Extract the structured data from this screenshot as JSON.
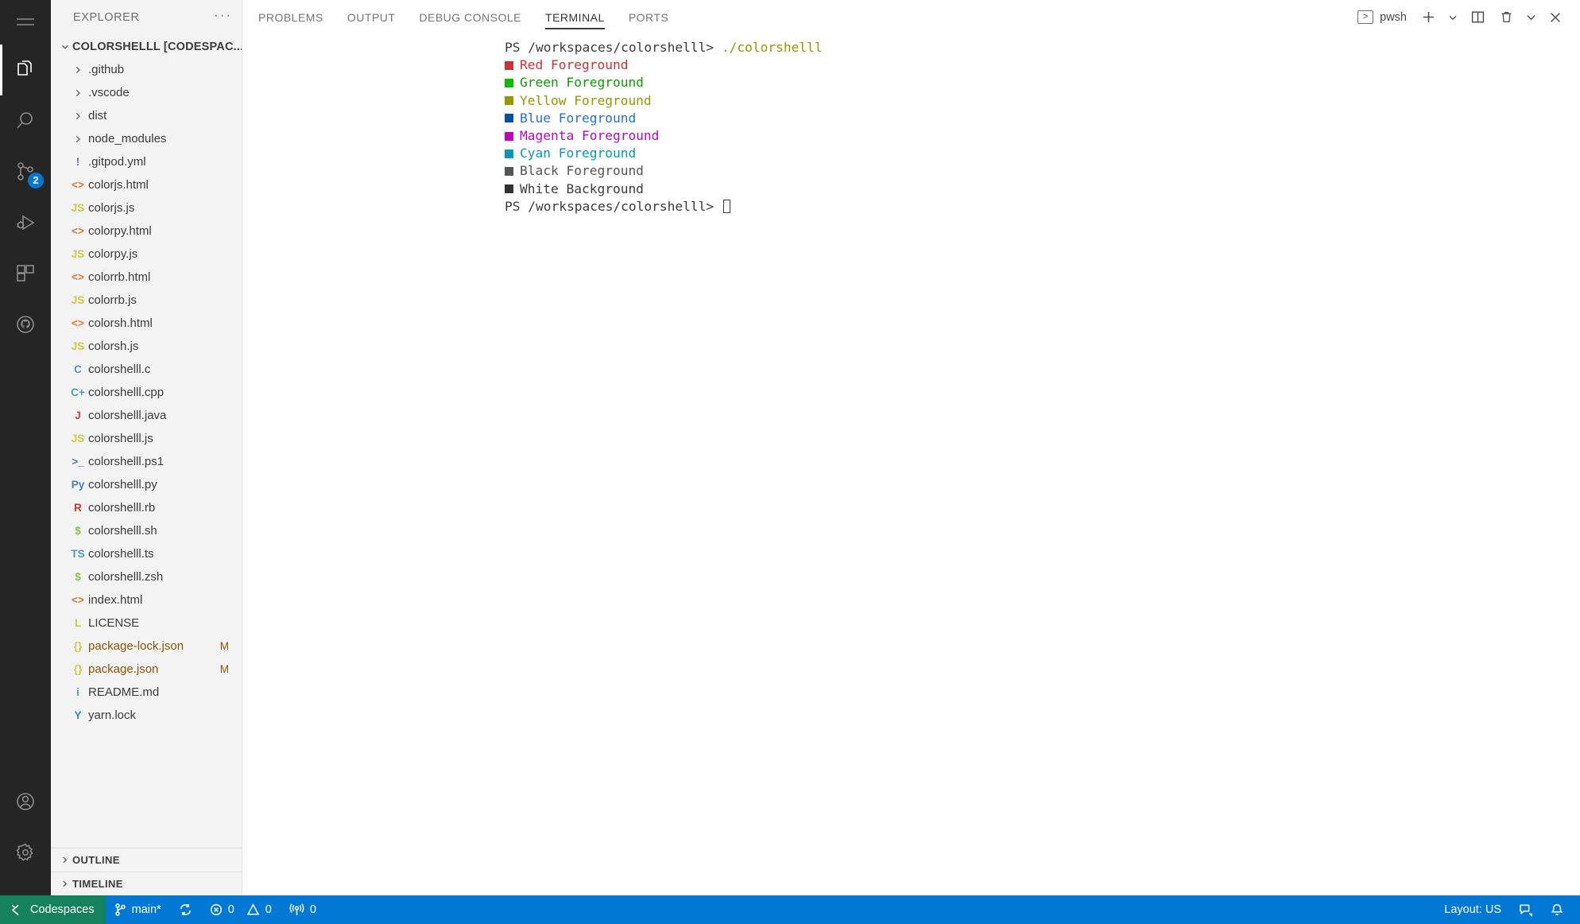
{
  "activity_bar": {
    "items": [
      {
        "name": "menu",
        "icon": "hamburger-menu-icon",
        "active": false
      },
      {
        "name": "explorer",
        "icon": "files-explorer-icon",
        "active": true
      },
      {
        "name": "search",
        "icon": "search-icon",
        "active": false
      },
      {
        "name": "source-control",
        "icon": "source-control-icon",
        "active": false,
        "badge": "2"
      },
      {
        "name": "run-and-debug",
        "icon": "run-and-debug-icon",
        "active": false
      },
      {
        "name": "extensions",
        "icon": "extensions-icon",
        "active": false
      },
      {
        "name": "github",
        "icon": "github-icon",
        "active": false
      }
    ],
    "bottom_items": [
      {
        "name": "accounts",
        "icon": "account-icon"
      },
      {
        "name": "manage-settings",
        "icon": "gear-icon"
      }
    ]
  },
  "sidebar": {
    "title": "EXPLORER",
    "more_actions": "···",
    "root_label": "COLORSHELLL [CODESPAC...",
    "files": [
      {
        "name": ".github",
        "icon": "chevron-right",
        "icon_type": "folder",
        "color": "#5f5f5f",
        "status": ""
      },
      {
        "name": ".vscode",
        "icon": "chevron-right",
        "icon_type": "folder",
        "color": "#5f5f5f",
        "status": ""
      },
      {
        "name": "dist",
        "icon": "chevron-right",
        "icon_type": "folder",
        "color": "#5f5f5f",
        "status": ""
      },
      {
        "name": "node_modules",
        "icon": "chevron-right",
        "icon_type": "folder",
        "color": "#5f5f5f",
        "status": ""
      },
      {
        "name": ".gitpod.yml",
        "icon": "!",
        "icon_type": "yaml-file-icon",
        "color": "#8b5ebd",
        "status": ""
      },
      {
        "name": "colorjs.html",
        "icon": "<>",
        "icon_type": "html-file-icon",
        "color": "#e37933",
        "status": ""
      },
      {
        "name": "colorjs.js",
        "icon": "JS",
        "icon_type": "javascript-file-icon",
        "color": "#cbcb41",
        "status": ""
      },
      {
        "name": "colorpy.html",
        "icon": "<>",
        "icon_type": "html-file-icon",
        "color": "#e37933",
        "status": ""
      },
      {
        "name": "colorpy.js",
        "icon": "JS",
        "icon_type": "javascript-file-icon",
        "color": "#cbcb41",
        "status": ""
      },
      {
        "name": "colorrb.html",
        "icon": "<>",
        "icon_type": "html-file-icon",
        "color": "#e37933",
        "status": ""
      },
      {
        "name": "colorrb.js",
        "icon": "JS",
        "icon_type": "javascript-file-icon",
        "color": "#cbcb41",
        "status": ""
      },
      {
        "name": "colorsh.html",
        "icon": "<>",
        "icon_type": "html-file-icon",
        "color": "#e37933",
        "status": ""
      },
      {
        "name": "colorsh.js",
        "icon": "JS",
        "icon_type": "javascript-file-icon",
        "color": "#cbcb41",
        "status": ""
      },
      {
        "name": "colorshelll.c",
        "icon": "C",
        "icon_type": "c-file-icon",
        "color": "#519aba",
        "status": ""
      },
      {
        "name": "colorshelll.cpp",
        "icon": "C+",
        "icon_type": "cpp-file-icon",
        "color": "#519aba",
        "status": ""
      },
      {
        "name": "colorshelll.java",
        "icon": "J",
        "icon_type": "java-file-icon",
        "color": "#cc3e44",
        "status": ""
      },
      {
        "name": "colorshelll.js",
        "icon": "JS",
        "icon_type": "javascript-file-icon",
        "color": "#cbcb41",
        "status": ""
      },
      {
        "name": "colorshelll.ps1",
        "icon": ">_",
        "icon_type": "powershell-file-icon",
        "color": "#4f7cb5",
        "status": ""
      },
      {
        "name": "colorshelll.py",
        "icon": "Py",
        "icon_type": "python-file-icon",
        "color": "#4584b6",
        "status": ""
      },
      {
        "name": "colorshelll.rb",
        "icon": "R",
        "icon_type": "ruby-file-icon",
        "color": "#cc342d",
        "status": ""
      },
      {
        "name": "colorshelll.sh",
        "icon": "$",
        "icon_type": "shell-file-icon",
        "color": "#8dc149",
        "status": ""
      },
      {
        "name": "colorshelll.ts",
        "icon": "TS",
        "icon_type": "typescript-file-icon",
        "color": "#519aba",
        "status": ""
      },
      {
        "name": "colorshelll.zsh",
        "icon": "$",
        "icon_type": "shell-file-icon",
        "color": "#8dc149",
        "status": ""
      },
      {
        "name": "index.html",
        "icon": "<>",
        "icon_type": "html-file-icon",
        "color": "#e37933",
        "status": ""
      },
      {
        "name": "LICENSE",
        "icon": "L",
        "icon_type": "license-file-icon",
        "color": "#cbcb41",
        "status": ""
      },
      {
        "name": "package-lock.json",
        "icon": "{}",
        "icon_type": "json-file-icon",
        "color": "#cbcb41",
        "status": "M"
      },
      {
        "name": "package.json",
        "icon": "{}",
        "icon_type": "json-file-icon",
        "color": "#cbcb41",
        "status": "M"
      },
      {
        "name": "README.md",
        "icon": "i",
        "icon_type": "markdown-file-icon",
        "color": "#519aba",
        "status": ""
      },
      {
        "name": "yarn.lock",
        "icon": "Y",
        "icon_type": "yarn-file-icon",
        "color": "#2c8ebb",
        "status": ""
      }
    ],
    "sections": [
      {
        "label": "OUTLINE"
      },
      {
        "label": "TIMELINE"
      }
    ]
  },
  "panel": {
    "tabs": [
      {
        "label": "PROBLEMS",
        "active": false
      },
      {
        "label": "OUTPUT",
        "active": false
      },
      {
        "label": "DEBUG CONSOLE",
        "active": false
      },
      {
        "label": "TERMINAL",
        "active": true
      },
      {
        "label": "PORTS",
        "active": false
      }
    ],
    "shell_name": "pwsh",
    "shell_icon_glyph": ">",
    "actions": [
      {
        "name": "new-terminal",
        "icon": "plus-icon"
      },
      {
        "name": "terminal-profile-dropdown",
        "icon": "chevron-down-icon"
      },
      {
        "name": "split-terminal",
        "icon": "split-editor-icon"
      },
      {
        "name": "kill-terminal",
        "icon": "trash-icon"
      },
      {
        "name": "panel-views-dropdown",
        "icon": "chevron-down-icon"
      },
      {
        "name": "close-panel",
        "icon": "close-icon"
      }
    ]
  },
  "terminal": {
    "lines": [
      {
        "type": "prompt",
        "prompt": "PS /workspaces/colorshelll> ",
        "prompt_color": "#3b3b3b",
        "command": "./colorshelll",
        "command_color": "#949800"
      },
      {
        "type": "swatch",
        "swatch_color": "#cd3131",
        "text": "Red Foreground",
        "text_color": "#cd3131"
      },
      {
        "type": "swatch",
        "swatch_color": "#0dbc00",
        "text": "Green Foreground",
        "text_color": "#0b9e00"
      },
      {
        "type": "swatch",
        "swatch_color": "#949800",
        "text": "Yellow Foreground",
        "text_color": "#949800"
      },
      {
        "type": "swatch",
        "swatch_color": "#0451a5",
        "text": "Blue Foreground",
        "text_color": "#2472c8"
      },
      {
        "type": "swatch",
        "swatch_color": "#bc05bc",
        "text": "Magenta Foreground",
        "text_color": "#bc05bc"
      },
      {
        "type": "swatch",
        "swatch_color": "#0598bc",
        "text": "Cyan Foreground",
        "text_color": "#0598bc"
      },
      {
        "type": "swatch",
        "swatch_color": "#555555",
        "text": "Black Foreground",
        "text_color": "#555555"
      },
      {
        "type": "swatch",
        "swatch_color": "#333333",
        "text": "White Background",
        "text_color": "#3b3b3b"
      },
      {
        "type": "prompt_caret",
        "prompt": "PS /workspaces/colorshelll> ",
        "prompt_color": "#3b3b3b"
      }
    ]
  },
  "status_bar": {
    "codespaces_label": "Codespaces",
    "branch_label": "main*",
    "sync_icon": "sync-icon",
    "errors_count": "0",
    "warnings_count": "0",
    "ports_count": "0",
    "layout_label": "Layout: US",
    "feedback_icon": "feedback-icon",
    "bell_icon": "bell-icon",
    "bg_color": "#0078d4",
    "codespaces_bg": "#16825d"
  }
}
